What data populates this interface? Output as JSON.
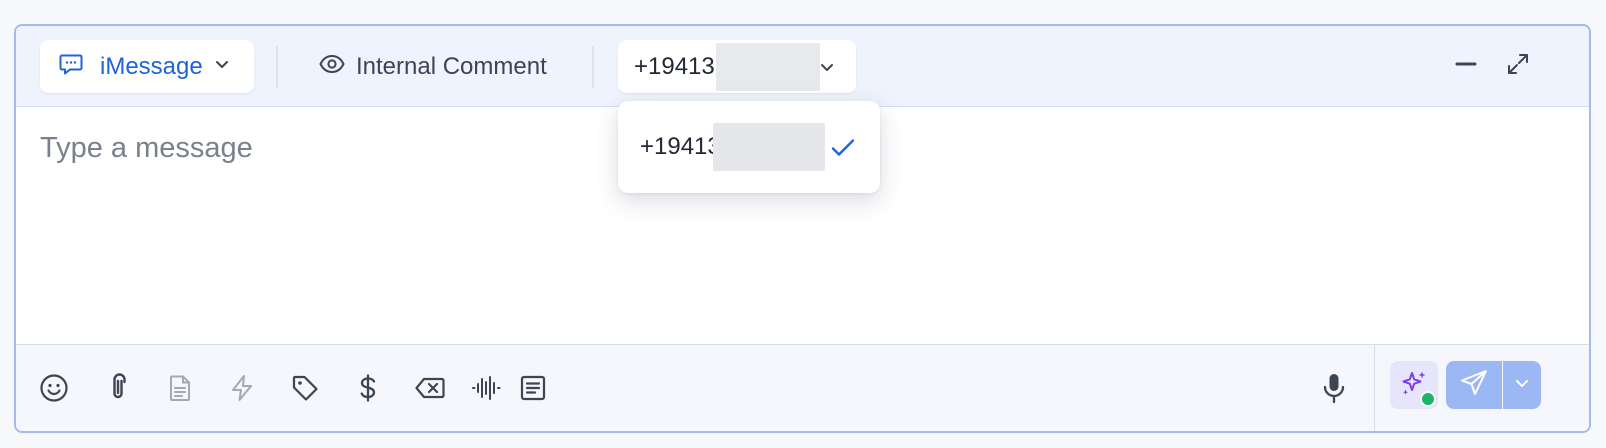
{
  "header": {
    "channel": {
      "label": "iMessage",
      "icon": "chat-bubble-icon"
    },
    "internal_comment": {
      "label": "Internal Comment",
      "icon": "eye-icon"
    },
    "phone_select": {
      "selected": "+19413"
    },
    "actions": [
      "minimize-icon",
      "expand-icon"
    ]
  },
  "composer": {
    "placeholder": "Type a message",
    "value": ""
  },
  "dropdown": {
    "options": [
      {
        "label": "+19413",
        "selected": true
      }
    ]
  },
  "toolbar": {
    "tools": [
      "emoji-icon",
      "paperclip-icon",
      "document-icon",
      "lightning-icon",
      "tag-icon",
      "dollar-icon",
      "clear-icon",
      "audio-wave-icon",
      "template-icon"
    ]
  },
  "colors": {
    "accent": "#1f63d8",
    "header_bg": "#eef3fd",
    "send_button": "#9bb8f5",
    "ai_button_bg": "#e7e5fb",
    "ai_icon": "#7b3fe4",
    "status_dot": "#22b36b"
  }
}
